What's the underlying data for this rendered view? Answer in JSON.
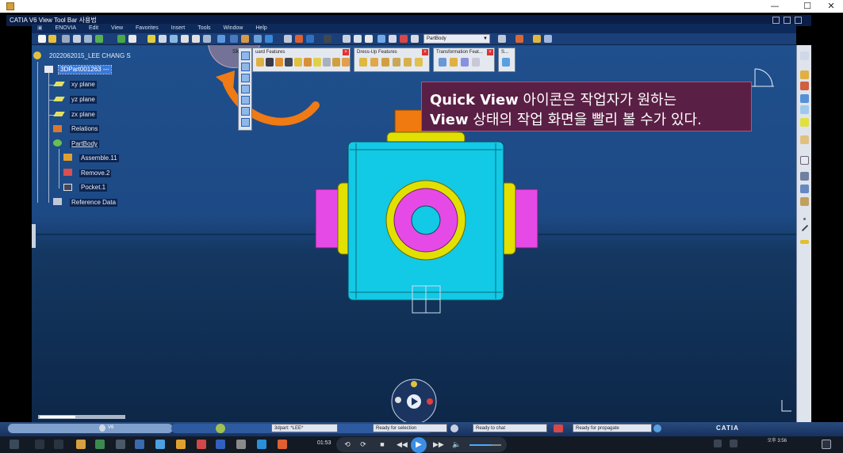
{
  "outer_window": {
    "minimize": "—",
    "maximize": "☐",
    "close": "✕"
  },
  "catia": {
    "window_title": "CATIA V6 View Tool Bar 사용법",
    "menus": [
      "ENOVIA",
      "Edit",
      "View",
      "Favorites",
      "Insert",
      "Tools",
      "Window",
      "Help"
    ],
    "partbody_select": "PartBody"
  },
  "tree": {
    "owner": "2022062015_LEE CHANG S",
    "root": "3DPart001263 ---",
    "items": [
      "xy plane",
      "yz plane",
      "zx plane",
      "Relations",
      "PartBody",
      "Assemble.11",
      "Remove.2",
      "Pocket.1",
      "Reference Data"
    ]
  },
  "floating_toolbars": [
    {
      "title": "Sk",
      "title2": "uard Features"
    },
    {
      "title": "Dress-Up Features"
    },
    {
      "title": "Transformation Feat..."
    },
    {
      "title": "S..."
    }
  ],
  "annotation": {
    "line1_bold": "Quick View",
    "line1_rest": " 아이콘은 작업자가 원하는",
    "line2_bold": "View",
    "line2_rest": " 상태의 작업 화면을 빨리 볼 수가 있다."
  },
  "status": {
    "v6": "V6",
    "field1": "3dpart: *LEE*",
    "field2": "Ready for selection",
    "field3": "Ready to chat",
    "field4": "Ready for propagate",
    "logo": "CATIA"
  },
  "player": {
    "time": "01:53",
    "clock_time": "오후 3:56"
  },
  "colors": {
    "cube": "#12c9e6",
    "yellow_ring": "#e2e000",
    "magenta": "#e64ae6",
    "orange": "#f07a10",
    "annotation_bg": "#5a1f45",
    "arrow": "#f07a14"
  }
}
